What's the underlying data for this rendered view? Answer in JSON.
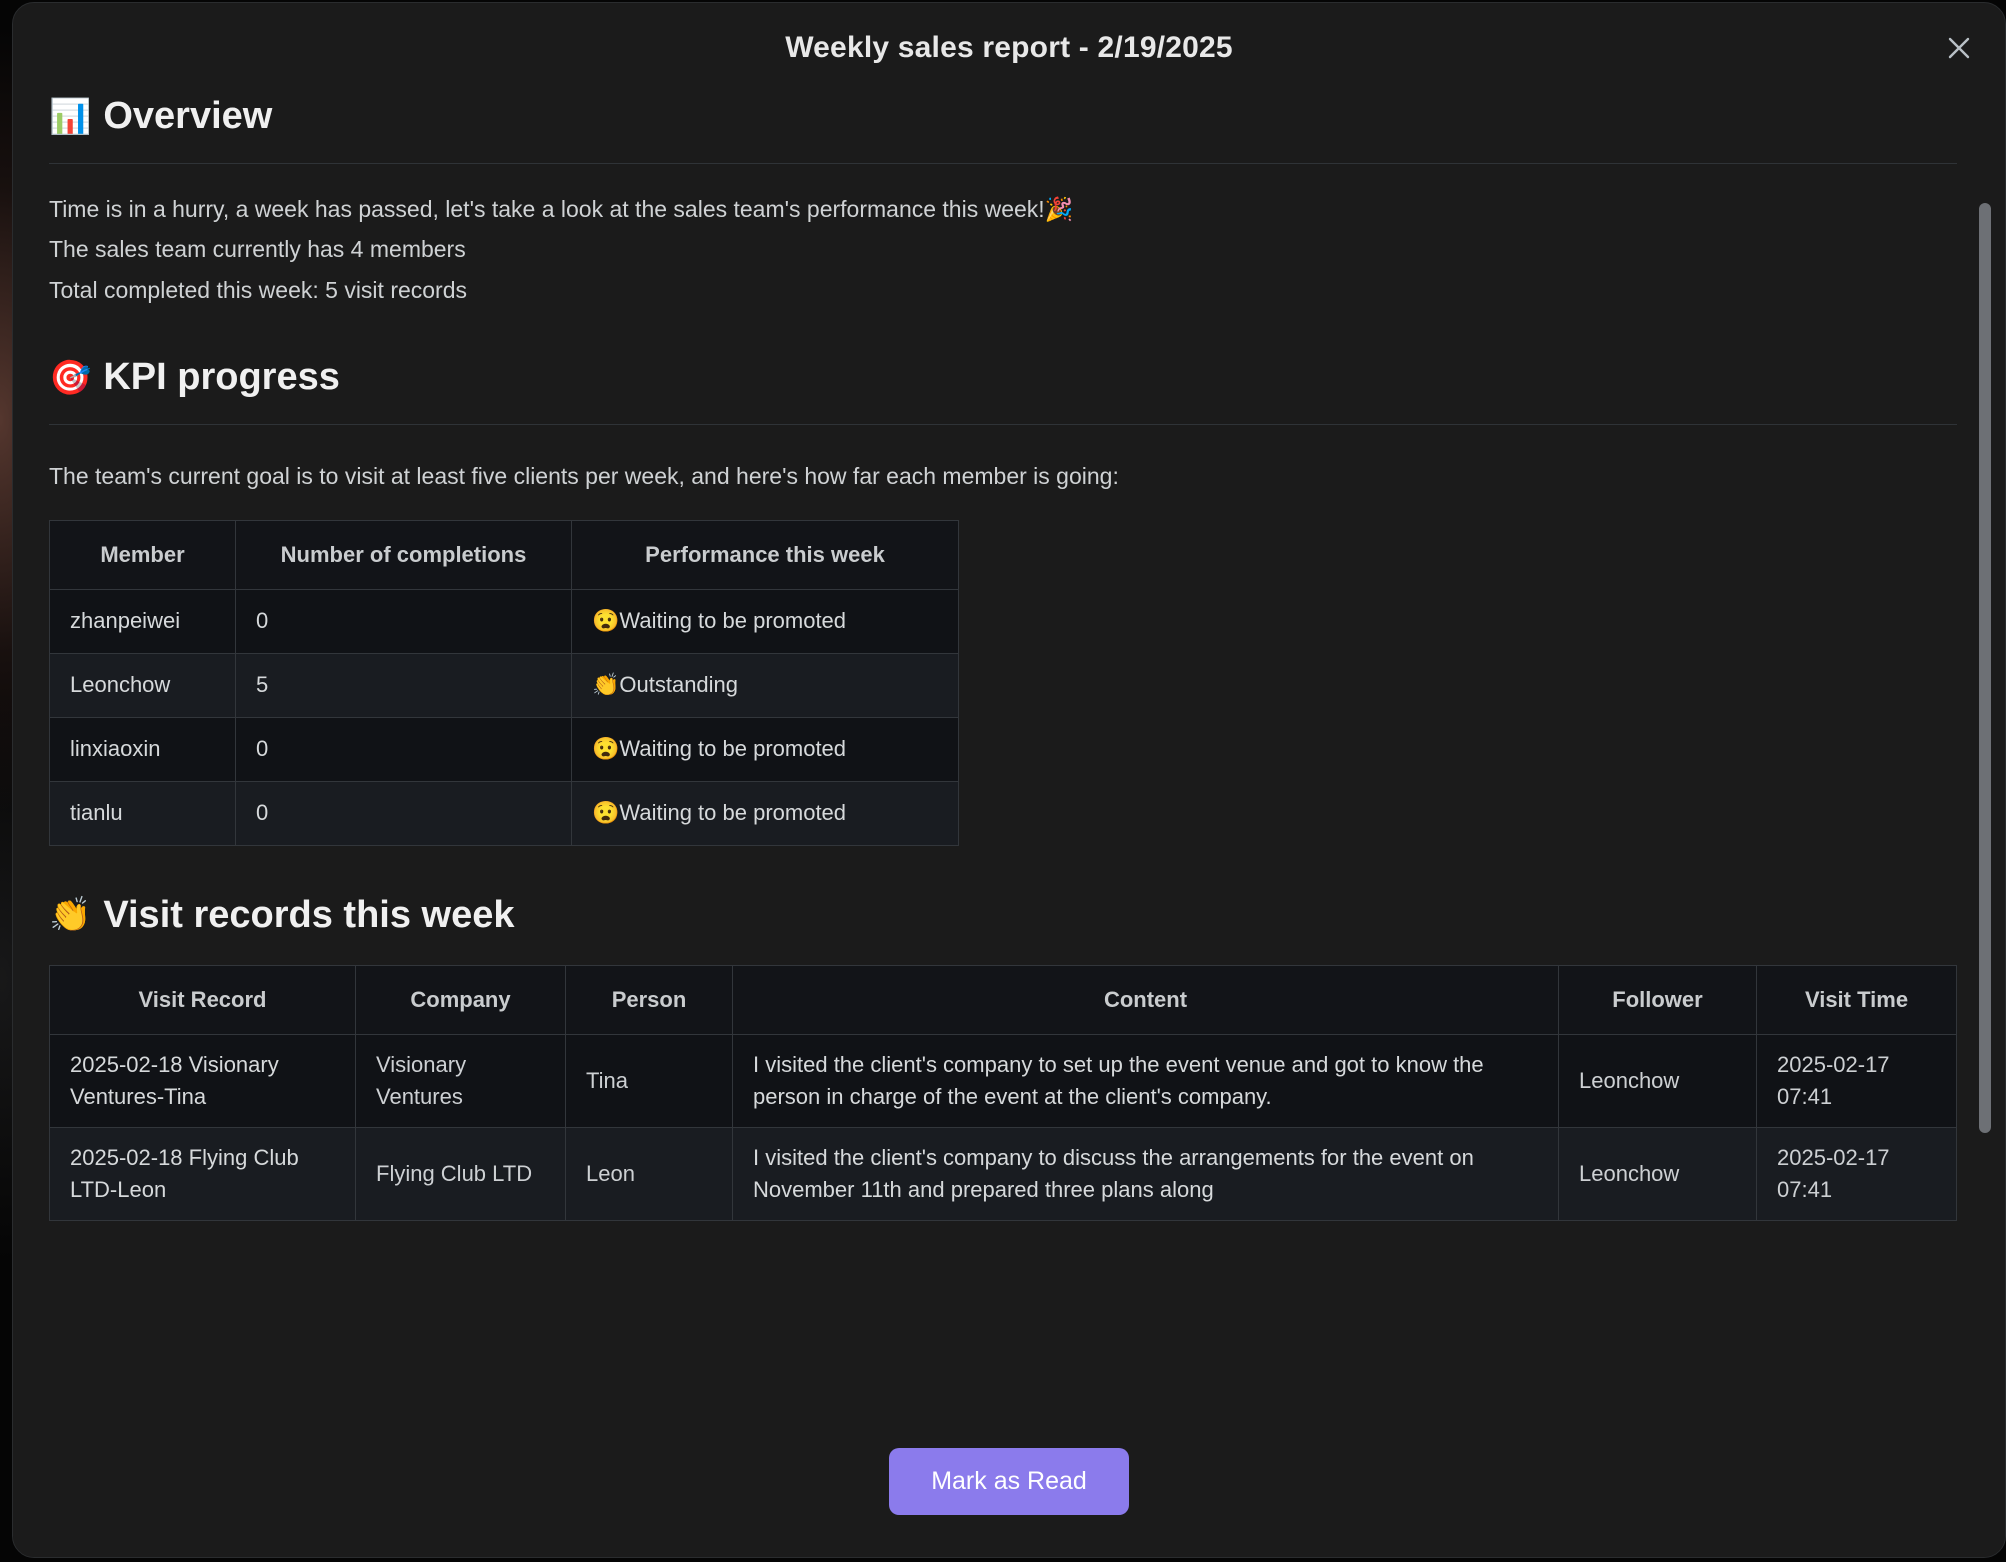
{
  "window": {
    "title": "Weekly sales report - 2/19/2025",
    "close_label": "×"
  },
  "overview": {
    "emoji": "📊",
    "heading": "Overview",
    "lines": [
      "Time is in a hurry, a week has passed, let's take a look at the sales team's performance this week!🎉",
      "The sales team currently has 4 members",
      "Total completed this week: 5 visit records"
    ]
  },
  "kpi": {
    "emoji": "🎯",
    "heading": "KPI progress",
    "intro": "The team's current goal is to visit at least five clients per week, and here's how far each member is going:",
    "columns": [
      "Member",
      "Number of completions",
      "Performance this week"
    ],
    "rows": [
      {
        "member": "zhanpeiwei",
        "completions": "0",
        "performance": "😧Waiting to be promoted"
      },
      {
        "member": "Leonchow",
        "completions": "5",
        "performance": "👏Outstanding"
      },
      {
        "member": "linxiaoxin",
        "completions": "0",
        "performance": "😧Waiting to be promoted"
      },
      {
        "member": "tianlu",
        "completions": "0",
        "performance": "😧Waiting to be promoted"
      }
    ]
  },
  "visits": {
    "emoji": "👏",
    "heading": "Visit records this week",
    "columns": [
      "Visit Record",
      "Company",
      "Person",
      "Content",
      "Follower",
      "Visit Time"
    ],
    "rows": [
      {
        "record": "2025-02-18 Visionary Ventures-Tina",
        "company": "Visionary Ventures",
        "person": "Tina",
        "content": "I visited the client's company to set up the event venue and got to know the person in charge of the event at the client's company.",
        "follower": "Leonchow",
        "time": "2025-02-17 07:41"
      },
      {
        "record": "2025-02-18 Flying Club LTD-Leon",
        "company": "Flying Club LTD",
        "person": "Leon",
        "content": "I visited the client's company to discuss the arrangements for the event on November 11th and prepared three plans along",
        "follower": "Leonchow",
        "time": "2025-02-17 07:41"
      }
    ]
  },
  "footer": {
    "primary_button": "Mark as Read"
  },
  "colors": {
    "accent": "#8B7BEC",
    "modal_bg": "#1b1b1b",
    "row_odd": "#101216",
    "row_even": "#191c21",
    "border": "#32363b",
    "text": "#d6d9db"
  }
}
